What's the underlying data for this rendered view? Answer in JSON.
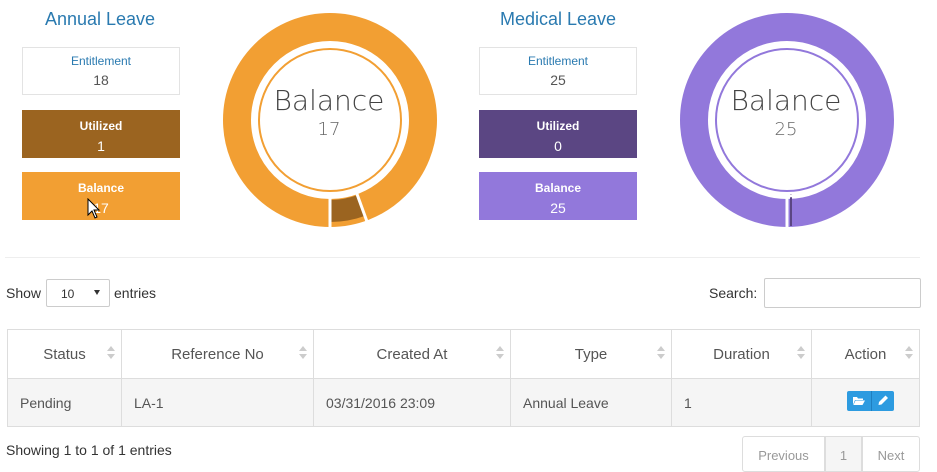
{
  "annual": {
    "title": "Annual Leave",
    "entitlement_label": "Entitlement",
    "entitlement_value": "18",
    "utilized_label": "Utilized",
    "utilized_value": "1",
    "balance_label": "Balance",
    "balance_value": "17",
    "donut_label": "Balance",
    "donut_value": "17",
    "colors": {
      "balance": "#f29f33",
      "utilized": "#9b6420"
    },
    "utilized_fraction": 0.0556
  },
  "medical": {
    "title": "Medical Leave",
    "entitlement_label": "Entitlement",
    "entitlement_value": "25",
    "utilized_label": "Utilized",
    "utilized_value": "0",
    "balance_label": "Balance",
    "balance_value": "25",
    "donut_label": "Balance",
    "donut_value": "25",
    "colors": {
      "balance": "#9278db",
      "utilized": "#5b4683"
    },
    "utilized_fraction": 0.0
  },
  "table_controls": {
    "show_label": "Show",
    "page_size": "10",
    "entries_label": "entries",
    "search_label": "Search:"
  },
  "table": {
    "headers": [
      "Status",
      "Reference No",
      "Created At",
      "Type",
      "Duration",
      "Action"
    ],
    "rows": [
      {
        "status": "Pending",
        "reference": "LA-1",
        "created_at": "03/31/2016 23:09",
        "type": "Annual Leave",
        "duration": "1"
      }
    ],
    "action_icons": [
      "folder-open-icon",
      "pencil-icon"
    ]
  },
  "footer": {
    "info": "Showing 1 to 1 of 1 entries",
    "previous": "Previous",
    "page": "1",
    "next": "Next"
  }
}
